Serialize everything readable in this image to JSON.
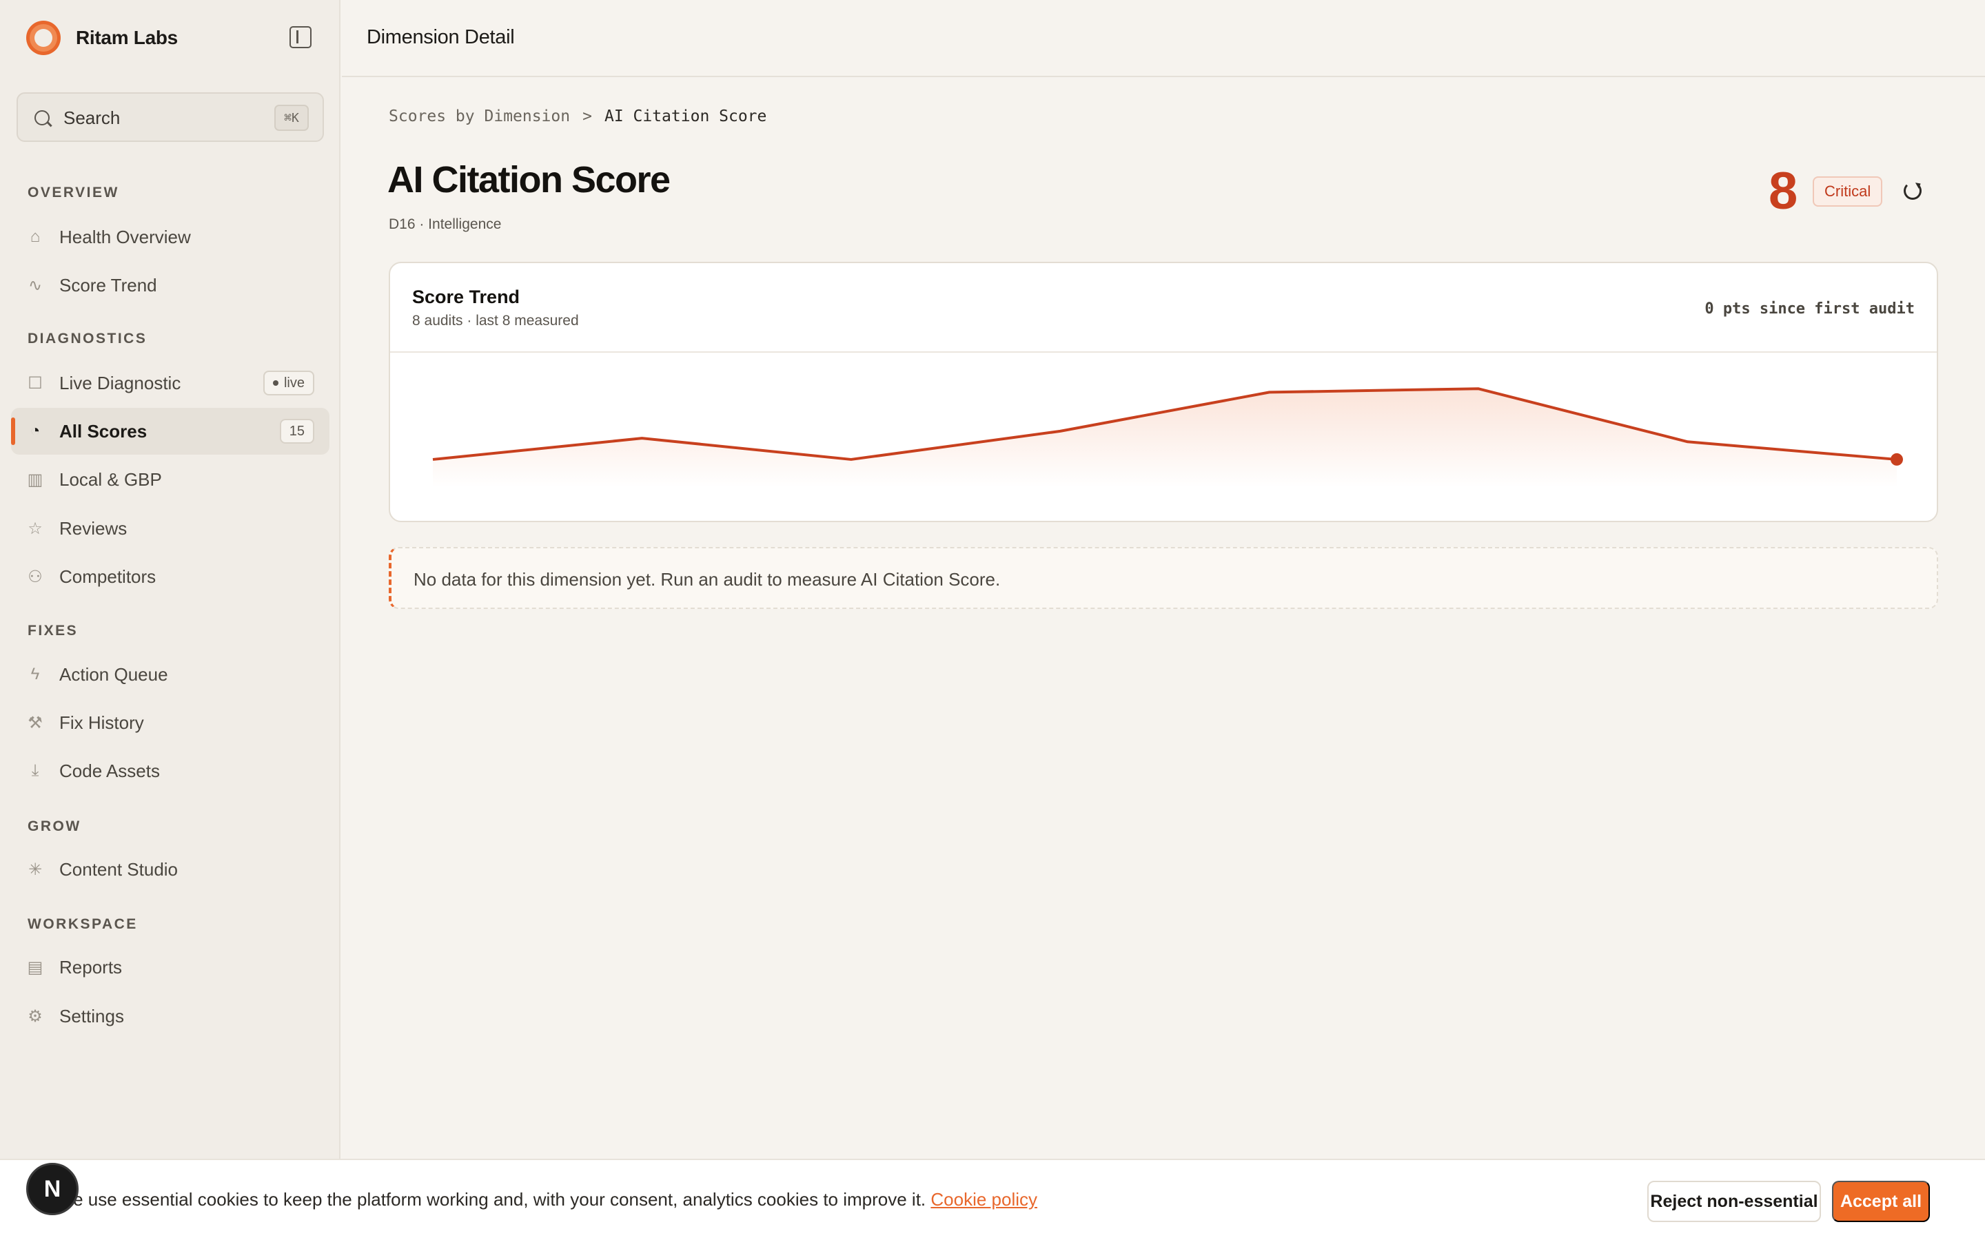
{
  "brand": {
    "name": "Ritam Labs"
  },
  "search": {
    "label": "Search",
    "shortcut": "⌘K"
  },
  "sidebar": {
    "sections": {
      "overview": "OVERVIEW",
      "diagnostics": "DIAGNOSTICS",
      "fixes": "FIXES",
      "grow": "GROW",
      "workspace": "WORKSPACE"
    },
    "items": {
      "health_overview": "Health Overview",
      "score_trend": "Score Trend",
      "live_diagnostic": "Live Diagnostic",
      "live_badge": "live",
      "all_scores": "All Scores",
      "all_scores_count": "15",
      "local_gbp": "Local & GBP",
      "reviews": "Reviews",
      "competitors": "Competitors",
      "action_queue": "Action Queue",
      "fix_history": "Fix History",
      "code_assets": "Code Assets",
      "content_studio": "Content Studio",
      "reports": "Reports",
      "settings": "Settings"
    }
  },
  "header": {
    "title": "Dimension Detail"
  },
  "breadcrumb": {
    "parent": "Scores by Dimension",
    "separator": ">",
    "current": "AI Citation Score"
  },
  "dimension": {
    "title": "AI Citation Score",
    "subtitle": "D16 · Intelligence",
    "score": "8",
    "status": "Critical"
  },
  "trend_card": {
    "title": "Score Trend",
    "subtitle": "8 audits · last 8 measured",
    "delta": "0 pts since first audit"
  },
  "chart_data": {
    "type": "area",
    "x": [
      1,
      2,
      3,
      4,
      5,
      6,
      7,
      8
    ],
    "series": [
      {
        "values": [
          8,
          14,
          8,
          16,
          27,
          28,
          13,
          8
        ]
      }
    ],
    "color": "#c8401e",
    "ylim": [
      0,
      30
    ],
    "grid": false
  },
  "notice": {
    "text": "No data for this dimension yet. Run an audit to measure AI Citation Score."
  },
  "cookie": {
    "text": "We use essential cookies to keep the platform working and, with your consent, analytics cookies to improve it.",
    "link": "Cookie policy",
    "reject": "Reject non-essential",
    "accept": "Accept all"
  },
  "avatar": {
    "initial": "N"
  },
  "colors": {
    "accent": "#e8672c",
    "critical": "#c8401e"
  }
}
